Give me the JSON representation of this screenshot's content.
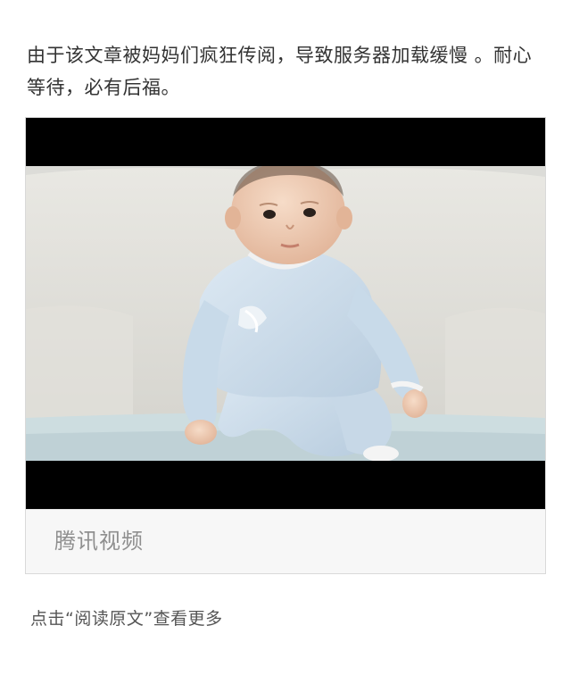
{
  "article": {
    "paragraph": "由于该文章被妈妈们疯狂传阅，导致服务器加载缓慢 。耐心等待，必有后福。"
  },
  "video": {
    "source_label": "腾讯视频",
    "thumbnail": "baby-in-light-blue-onesie-on-white-sofa"
  },
  "footer": {
    "read_more_label": "点击“阅读原文”查看更多"
  },
  "colors": {
    "text": "#333333",
    "muted": "#8f8f8f",
    "letterbox": "#000000",
    "onesie": "#cfe0ef"
  }
}
